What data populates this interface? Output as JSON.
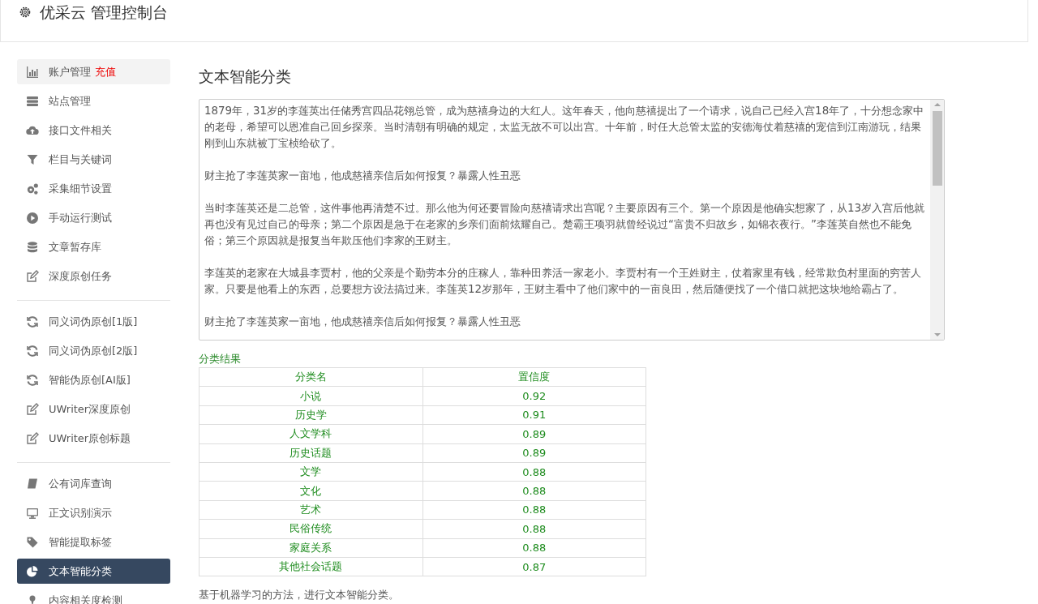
{
  "header": {
    "title": "优采云 管理控制台"
  },
  "sidebar": {
    "groups": [
      {
        "items": [
          {
            "label": "账户管理",
            "badge": "充值",
            "selected": false,
            "hovered": true
          },
          {
            "label": "站点管理",
            "selected": false,
            "hovered": false
          },
          {
            "label": "接口文件相关",
            "selected": false,
            "hovered": false
          },
          {
            "label": "栏目与关键词",
            "selected": false,
            "hovered": false
          },
          {
            "label": "采集细节设置",
            "selected": false,
            "hovered": false
          },
          {
            "label": "手动运行测试",
            "selected": false,
            "hovered": false
          },
          {
            "label": "文章暂存库",
            "selected": false,
            "hovered": false
          },
          {
            "label": "深度原创任务",
            "selected": false,
            "hovered": false
          }
        ]
      },
      {
        "items": [
          {
            "label": "同义词伪原创[1版]",
            "selected": false,
            "hovered": false
          },
          {
            "label": "同义词伪原创[2版]",
            "selected": false,
            "hovered": false
          },
          {
            "label": "智能伪原创[AI版]",
            "selected": false,
            "hovered": false
          },
          {
            "label": "UWriter深度原创",
            "selected": false,
            "hovered": false
          },
          {
            "label": "UWriter原创标题",
            "selected": false,
            "hovered": false
          }
        ]
      },
      {
        "items": [
          {
            "label": "公有词库查询",
            "selected": false,
            "hovered": false
          },
          {
            "label": "正文识别演示",
            "selected": false,
            "hovered": false
          },
          {
            "label": "智能提取标签",
            "selected": false,
            "hovered": false
          },
          {
            "label": "文本智能分类",
            "selected": true,
            "hovered": false
          },
          {
            "label": "内容相关度检测",
            "selected": false,
            "hovered": false
          }
        ]
      }
    ]
  },
  "main": {
    "title": "文本智能分类",
    "input_text": [
      "1879年，31岁的李莲英出任储秀宫四品花翎总管，成为慈禧身边的大红人。这年春天，他向慈禧提出了一个请求，说自己已经入宫18年了，十分想念家中的老母，希望可以恩准自己回乡探亲。当时清朝有明确的规定，太监无故不可以出宫。十年前，时任大总管太监的安德海仗着慈禧的宠信到江南游玩，结果刚到山东就被丁宝桢给砍了。",
      "财主抢了李莲英家一亩地，他成慈禧亲信后如何报复？暴露人性丑恶",
      "当时李莲英还是二总管，这件事他再清楚不过。那么他为何还要冒险向慈禧请求出宫呢？主要原因有三个。第一个原因是他确实想家了，从13岁入宫后他就再也没有见过自己的母亲；第二个原因是急于在老家的乡亲们面前炫耀自己。楚霸王项羽就曾经说过“富贵不归故乡，如锦衣夜行。”李莲英自然也不能免俗；第三个原因就是报复当年欺压他们李家的王财主。",
      "李莲英的老家在大城县李贾村，他的父亲是个勤劳本分的庄稼人，靠种田养活一家老小。李贾村有一个王姓财主，仗着家里有钱，经常欺负村里面的穷苦人家。只要是他看上的东西，总要想方设法搞过来。李莲英12岁那年，王财主看中了他们家中的一亩良田，然后随便找了一个借口就把这块地给霸占了。",
      "财主抢了李莲英家一亩地，他成慈禧亲信后如何报复？暴露人性丑恶"
    ],
    "result_label": "分类结果",
    "table": {
      "columns": [
        "分类名",
        "置信度"
      ],
      "rows": [
        [
          "小说",
          "0.92"
        ],
        [
          "历史学",
          "0.91"
        ],
        [
          "人文学科",
          "0.89"
        ],
        [
          "历史话题",
          "0.89"
        ],
        [
          "文学",
          "0.88"
        ],
        [
          "文化",
          "0.88"
        ],
        [
          "艺术",
          "0.88"
        ],
        [
          "民俗传统",
          "0.88"
        ],
        [
          "家庭关系",
          "0.88"
        ],
        [
          "其他社会话题",
          "0.87"
        ]
      ]
    },
    "note": "基于机器学习的方法，进行文本智能分类。"
  }
}
